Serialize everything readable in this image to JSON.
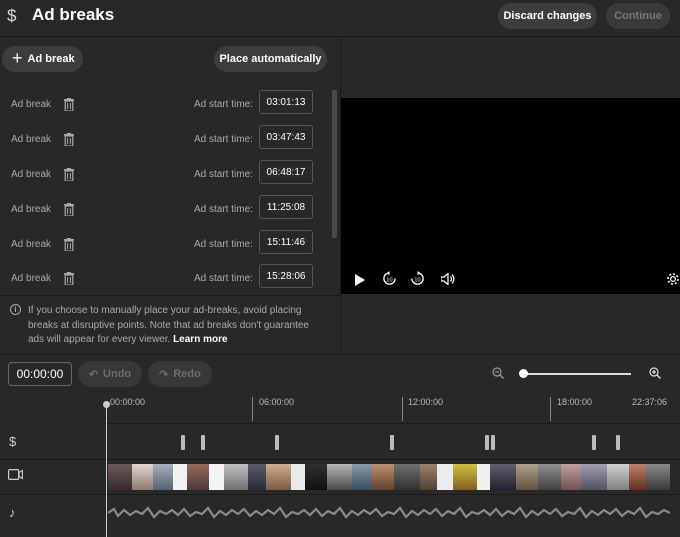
{
  "header": {
    "icon": "dollar-icon",
    "title": "Ad breaks",
    "discard_label": "Discard changes",
    "continue_label": "Continue"
  },
  "left_panel": {
    "add_label": "Ad break",
    "auto_label": "Place automatically",
    "ad_breaks": [
      {
        "label": "Ad break",
        "start_label": "Ad start time:",
        "time": "03:01:13"
      },
      {
        "label": "Ad break",
        "start_label": "Ad start time:",
        "time": "03:47:43"
      },
      {
        "label": "Ad break",
        "start_label": "Ad start time:",
        "time": "06:48:17"
      },
      {
        "label": "Ad break",
        "start_label": "Ad start time:",
        "time": "11:25:08"
      },
      {
        "label": "Ad break",
        "start_label": "Ad start time:",
        "time": "15:11:46"
      },
      {
        "label": "Ad break",
        "start_label": "Ad start time:",
        "time": "15:28:06"
      }
    ],
    "info_text": "If you choose to manually place your ad-breaks, avoid placing breaks at disruptive points. Note that ad breaks don't guarantee ads will appear for every viewer.",
    "learn_more": "Learn more"
  },
  "player": {
    "rewind_label": "10",
    "forward_label": "10"
  },
  "toolbar": {
    "time": "00:00:00",
    "undo_label": "Undo",
    "redo_label": "Redo",
    "zoom_level": 0
  },
  "timeline": {
    "ticks": [
      "00:00:00",
      "06:00:00",
      "12:00:00",
      "18:00:00",
      "22:37:06"
    ],
    "tracks": [
      "dollar-icon",
      "video-camera-icon",
      "music-note-icon"
    ]
  },
  "colors": {
    "background": "#282828",
    "button": "#3d3d3d",
    "video": "#000000"
  }
}
